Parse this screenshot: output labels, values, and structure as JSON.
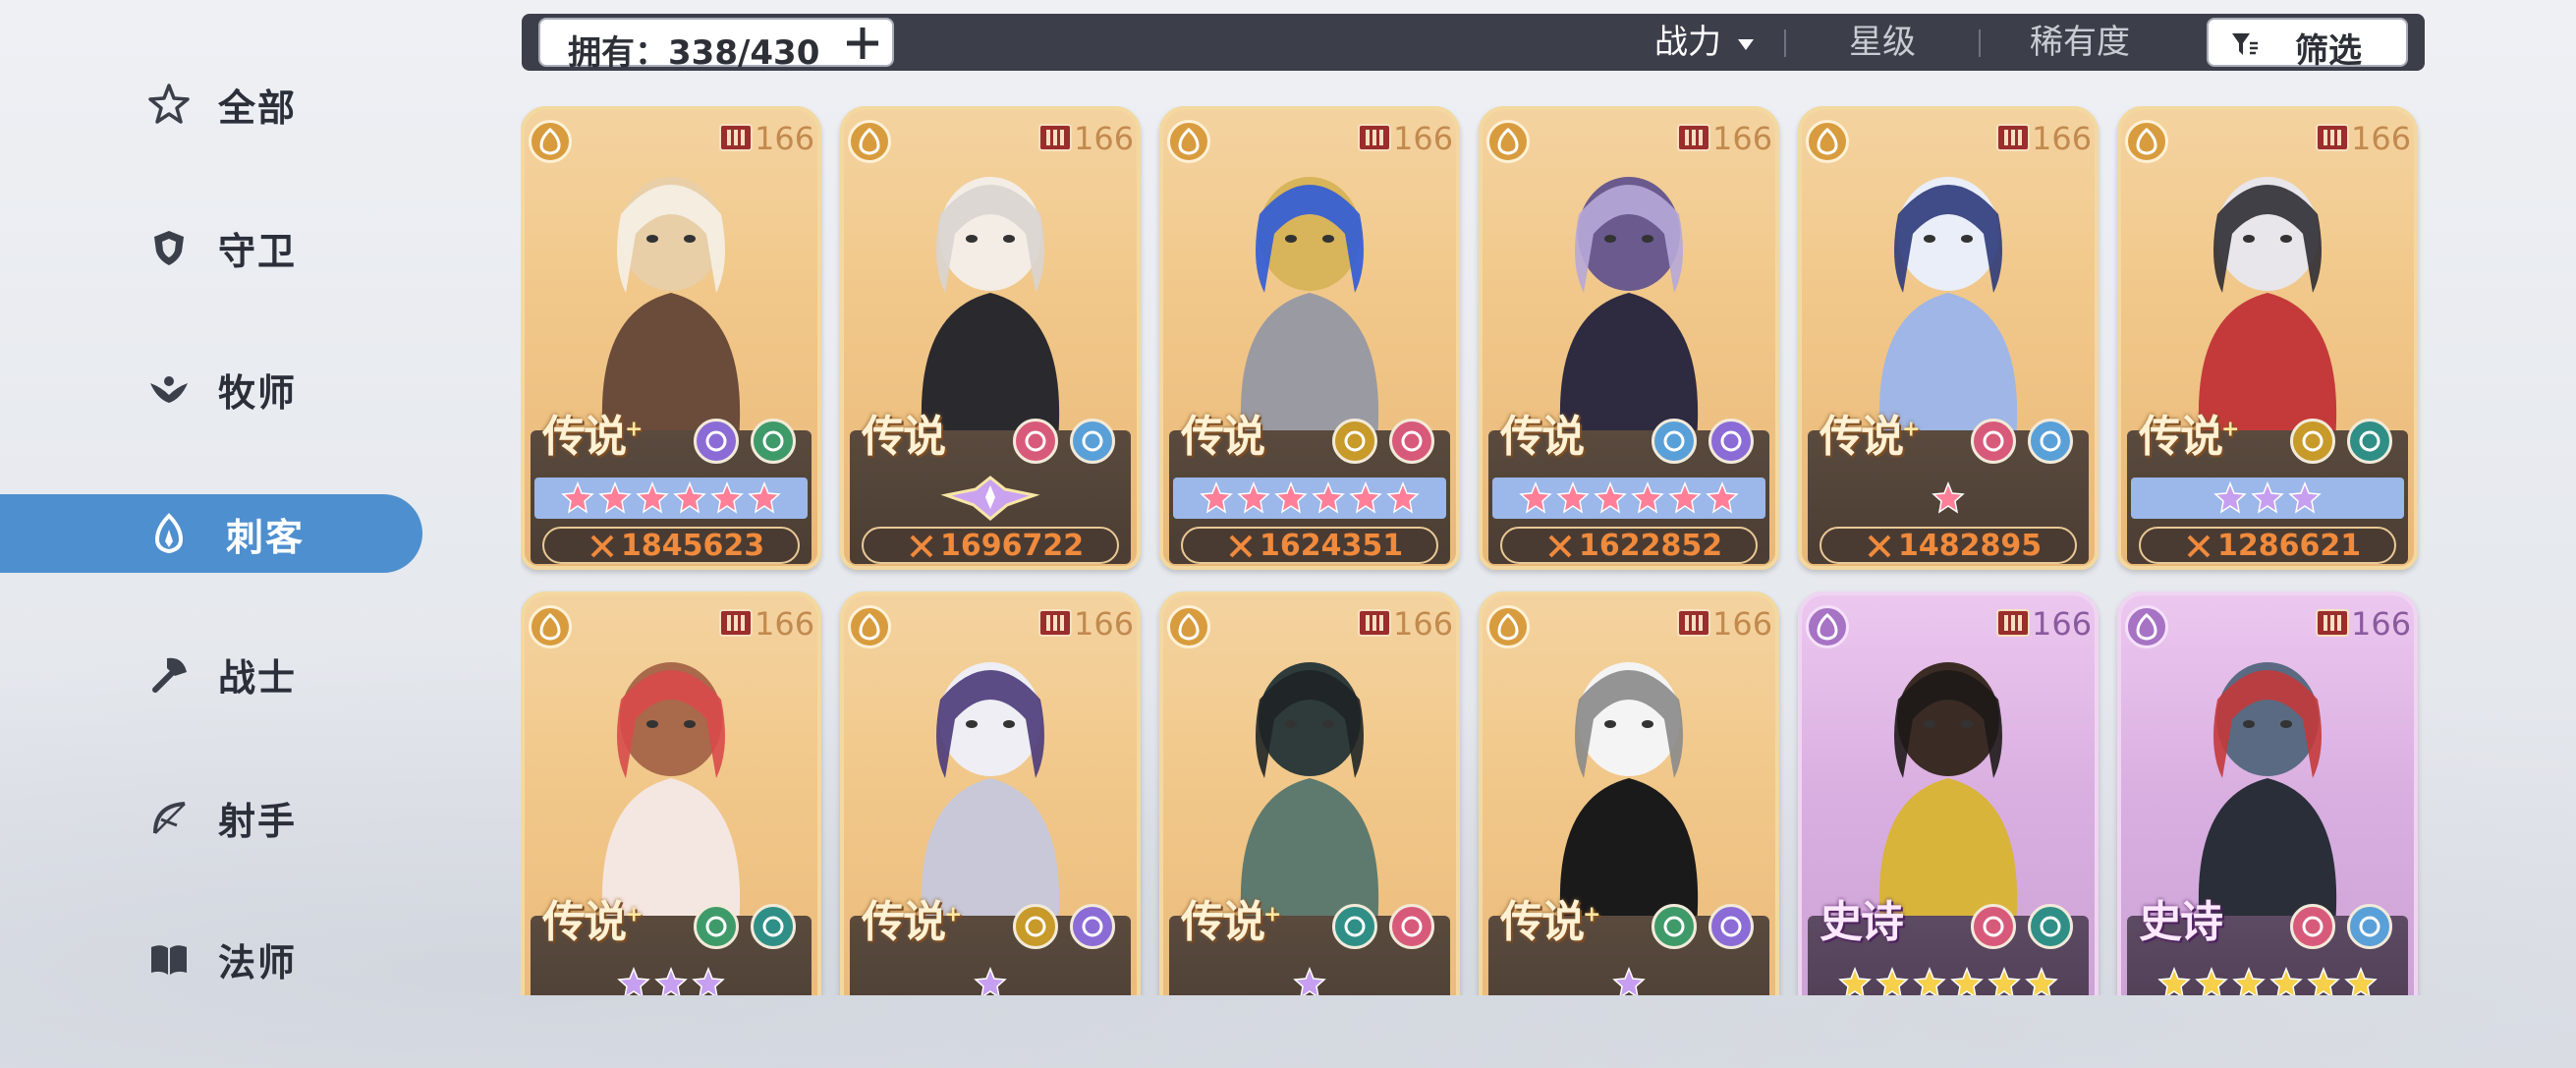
{
  "sidebar": {
    "items": [
      {
        "label": "全部",
        "icon": "star-outline-icon",
        "active": false
      },
      {
        "label": "守卫",
        "icon": "shield-icon",
        "active": false
      },
      {
        "label": "牧师",
        "icon": "wing-icon",
        "active": false
      },
      {
        "label": "刺客",
        "icon": "dagger-flame-icon",
        "active": true
      },
      {
        "label": "战士",
        "icon": "axe-icon",
        "active": false
      },
      {
        "label": "射手",
        "icon": "bow-icon",
        "active": false
      },
      {
        "label": "法师",
        "icon": "book-icon",
        "active": false
      }
    ]
  },
  "toolbar": {
    "owned_label": "拥有：338/430",
    "sort_power": "战力",
    "sort_star": "星级",
    "sort_rarity": "稀有度",
    "filter_label": "筛选"
  },
  "colors": {
    "accent": "#4e8fcf",
    "topbar": "#3c3f4a",
    "power_text": "#f08a3c"
  },
  "heroes": [
    {
      "level": "166",
      "rarity": "传说",
      "plus": "+",
      "elements": [
        "purple-rune",
        "green-lotus"
      ],
      "stars": 6,
      "star_color": "pink",
      "star_bar": "blue",
      "power": "1845623"
    },
    {
      "level": "166",
      "rarity": "传说",
      "plus": "",
      "elements": [
        "pink-swirl",
        "blue-snowflake"
      ],
      "stars": 0,
      "star_color": "medal",
      "star_bar": "plain",
      "power": "1696722"
    },
    {
      "level": "166",
      "rarity": "传说",
      "plus": "",
      "elements": [
        "gold-wing",
        "pink-swirl"
      ],
      "stars": 6,
      "star_color": "pink",
      "star_bar": "blue",
      "power": "1624351"
    },
    {
      "level": "166",
      "rarity": "传说",
      "plus": "",
      "elements": [
        "blue-snowflake",
        "purple-rune"
      ],
      "stars": 6,
      "star_color": "pink",
      "star_bar": "blue",
      "power": "1622852"
    },
    {
      "level": "166",
      "rarity": "传说",
      "plus": "+",
      "elements": [
        "pink-swirl",
        "blue-snowflake"
      ],
      "stars": 1,
      "star_color": "pink",
      "star_bar": "plain",
      "power": "1482895"
    },
    {
      "level": "166",
      "rarity": "传说",
      "plus": "+",
      "elements": [
        "gold-wing",
        "teal-infinity"
      ],
      "stars": 3,
      "star_color": "purple",
      "star_bar": "blue",
      "power": "1286621"
    },
    {
      "level": "166",
      "rarity": "传说",
      "plus": "+",
      "elements": [
        "green-lotus",
        "teal-infinity"
      ],
      "stars": 3,
      "star_color": "purple",
      "star_bar": "plain",
      "power": ""
    },
    {
      "level": "166",
      "rarity": "传说",
      "plus": "+",
      "elements": [
        "gold-wing",
        "purple-rune"
      ],
      "stars": 1,
      "star_color": "purple",
      "star_bar": "plain",
      "power": ""
    },
    {
      "level": "166",
      "rarity": "传说",
      "plus": "+",
      "elements": [
        "teal-infinity",
        "pink-swirl"
      ],
      "stars": 1,
      "star_color": "purple",
      "star_bar": "plain",
      "power": ""
    },
    {
      "level": "166",
      "rarity": "传说",
      "plus": "+",
      "elements": [
        "green-lotus",
        "purple-rune"
      ],
      "stars": 1,
      "star_color": "purple",
      "star_bar": "plain",
      "power": ""
    },
    {
      "level": "166",
      "rarity": "史诗",
      "plus": "",
      "elements": [
        "pink-swirl",
        "teal-infinity"
      ],
      "stars": 6,
      "star_color": "gold",
      "star_bar": "plain",
      "power": ""
    },
    {
      "level": "166",
      "rarity": "史诗",
      "plus": "",
      "elements": [
        "pink-swirl",
        "blue-snowflake"
      ],
      "stars": 6,
      "star_color": "gold",
      "star_bar": "plain",
      "power": ""
    }
  ]
}
